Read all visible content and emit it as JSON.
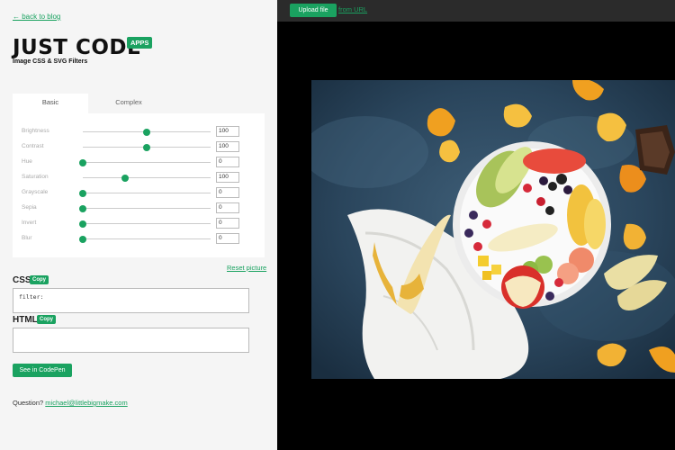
{
  "back_link": "← back to blog",
  "brand": {
    "title": "JUST CODE",
    "badge": "APPS",
    "subtitle": "Image CSS & SVG Filters"
  },
  "tabs": [
    {
      "label": "Basic"
    },
    {
      "label": "Complex"
    }
  ],
  "sliders": [
    {
      "label": "Brightness",
      "value": "100",
      "fraction": 0.5
    },
    {
      "label": "Contrast",
      "value": "100",
      "fraction": 0.5
    },
    {
      "label": "Hue",
      "value": "0",
      "fraction": 0.0
    },
    {
      "label": "Saturation",
      "value": "100",
      "fraction": 0.33
    },
    {
      "label": "Grayscale",
      "value": "0",
      "fraction": 0.0
    },
    {
      "label": "Sepia",
      "value": "0",
      "fraction": 0.0
    },
    {
      "label": "Invert",
      "value": "0",
      "fraction": 0.0
    },
    {
      "label": "Blur",
      "value": "0",
      "fraction": 0.0
    }
  ],
  "reset_link": "Reset picture",
  "css_section": {
    "label": "CSS",
    "copy_label": "Copy",
    "code": "filter:"
  },
  "html_section": {
    "label": "HTML",
    "copy_label": "Copy",
    "code": ""
  },
  "codepen_button": "See in CodePen",
  "question": {
    "prefix": "Question?",
    "email": "michael@littlebigmake.com"
  },
  "toolbar": {
    "upload_label": "Upload file",
    "from_url_label": "from URL"
  },
  "colors": {
    "accent": "#1aa260",
    "left_bg": "#f5f5f5",
    "right_bg": "#000000",
    "topbar": "#2b2b2b"
  }
}
